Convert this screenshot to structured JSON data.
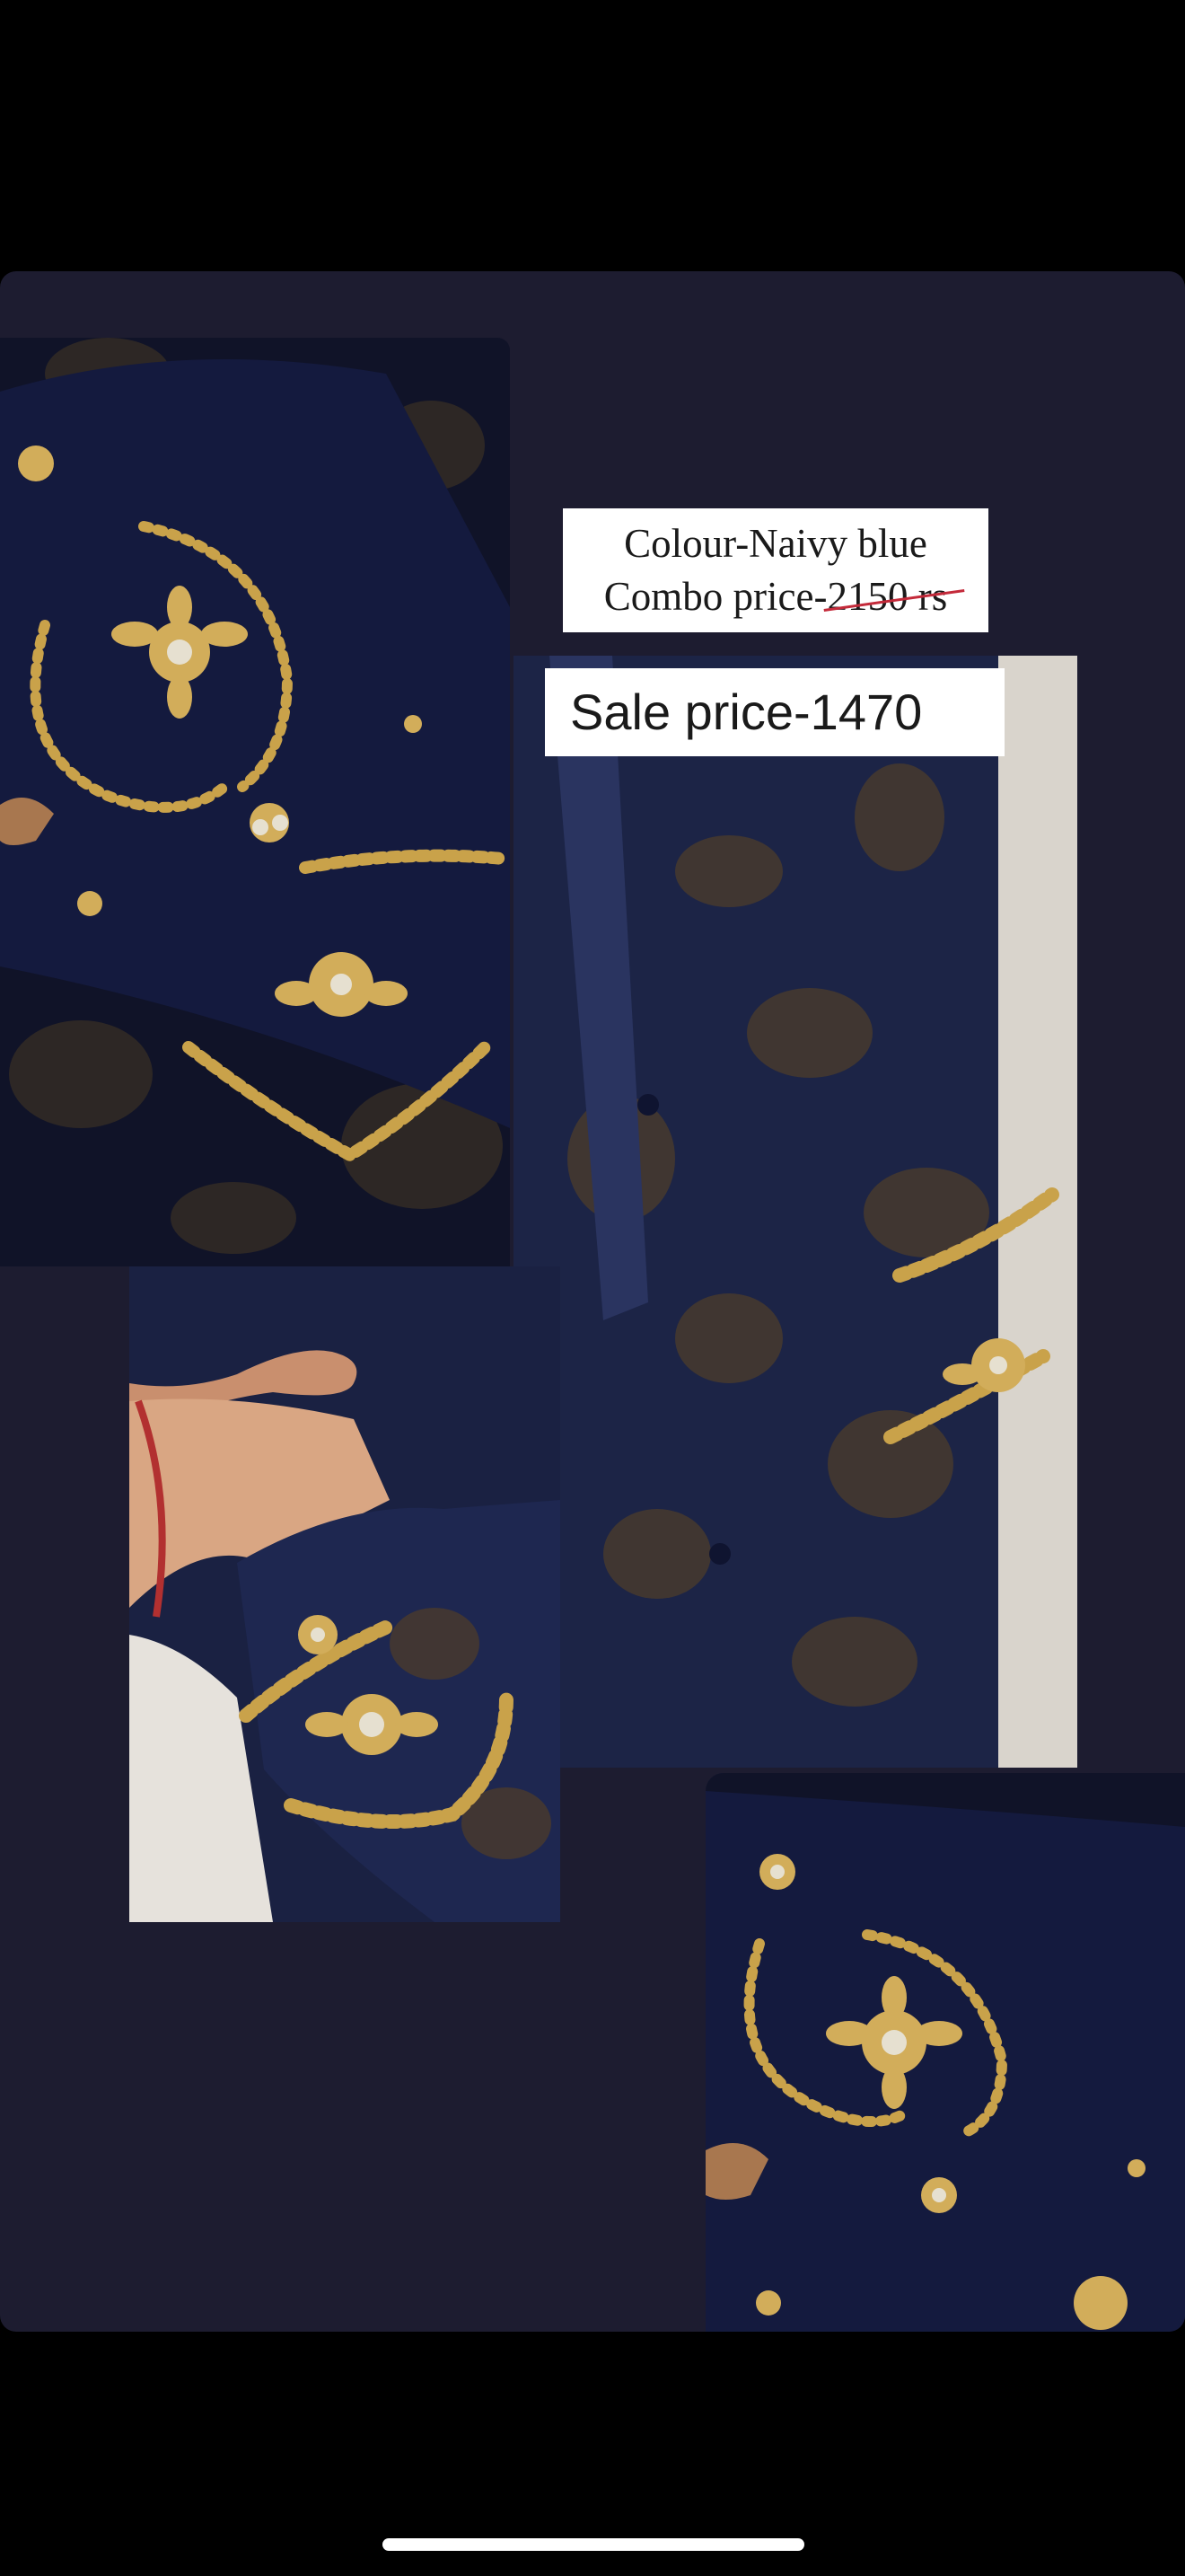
{
  "colour_label": "Colour-Naivy blue",
  "combo_price_prefix": "Combo price-",
  "combo_price_old": "2150 rs",
  "sale_price": "Sale price-1470",
  "colors": {
    "background": "#000000",
    "card": "#1d1c30",
    "fabric_navy": "#14183a",
    "embroidery_gold": "#c9a24a",
    "strike_red": "#c42a3a"
  },
  "photos": [
    {
      "name": "clutch-top-photo"
    },
    {
      "name": "jacket-photo"
    },
    {
      "name": "sleeve-photo"
    },
    {
      "name": "clutch-bottom-photo"
    }
  ]
}
